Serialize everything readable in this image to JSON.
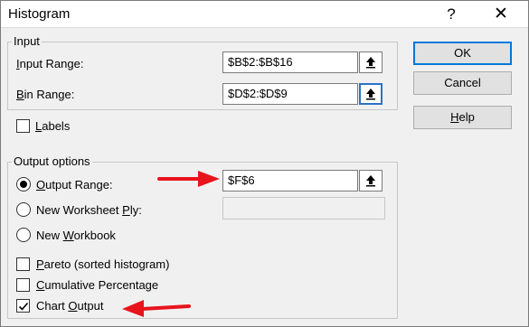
{
  "window": {
    "title": "Histogram",
    "help_glyph": "?",
    "close_glyph": "✕"
  },
  "input_group": {
    "label": "Input",
    "input_range": {
      "label_accel": "I",
      "label_rest": "nput Range:",
      "value": "$B$2:$B$16"
    },
    "bin_range": {
      "label_accel": "B",
      "label_rest": "in Range:",
      "value": "$D$2:$D$9"
    }
  },
  "labels_checkbox": {
    "label_accel": "L",
    "label_rest": "abels",
    "checked": false
  },
  "output_group": {
    "label": "Output options",
    "output_range": {
      "label_accel": "O",
      "label_rest": "utput Range:",
      "value": "$F$6",
      "selected": true
    },
    "new_worksheet": {
      "label_pre": "New Worksheet ",
      "label_accel": "P",
      "label_post": "ly:",
      "value": ""
    },
    "new_workbook": {
      "label_pre": "New ",
      "label_accel": "W",
      "label_post": "orkbook"
    },
    "pareto": {
      "label_accel": "P",
      "label_rest": "areto (sorted histogram)",
      "checked": false
    },
    "cumulative": {
      "label_pre": "",
      "label_accel": "C",
      "label_rest": "umulative Percentage",
      "checked": false
    },
    "chart_output": {
      "label_pre": "Chart ",
      "label_accel": "O",
      "label_rest": "utput",
      "checked": true
    }
  },
  "buttons": {
    "ok": "OK",
    "cancel": "Cancel",
    "help_accel": "H",
    "help_rest": "elp"
  },
  "annotations": {
    "arrow_color": "#e8141c"
  }
}
